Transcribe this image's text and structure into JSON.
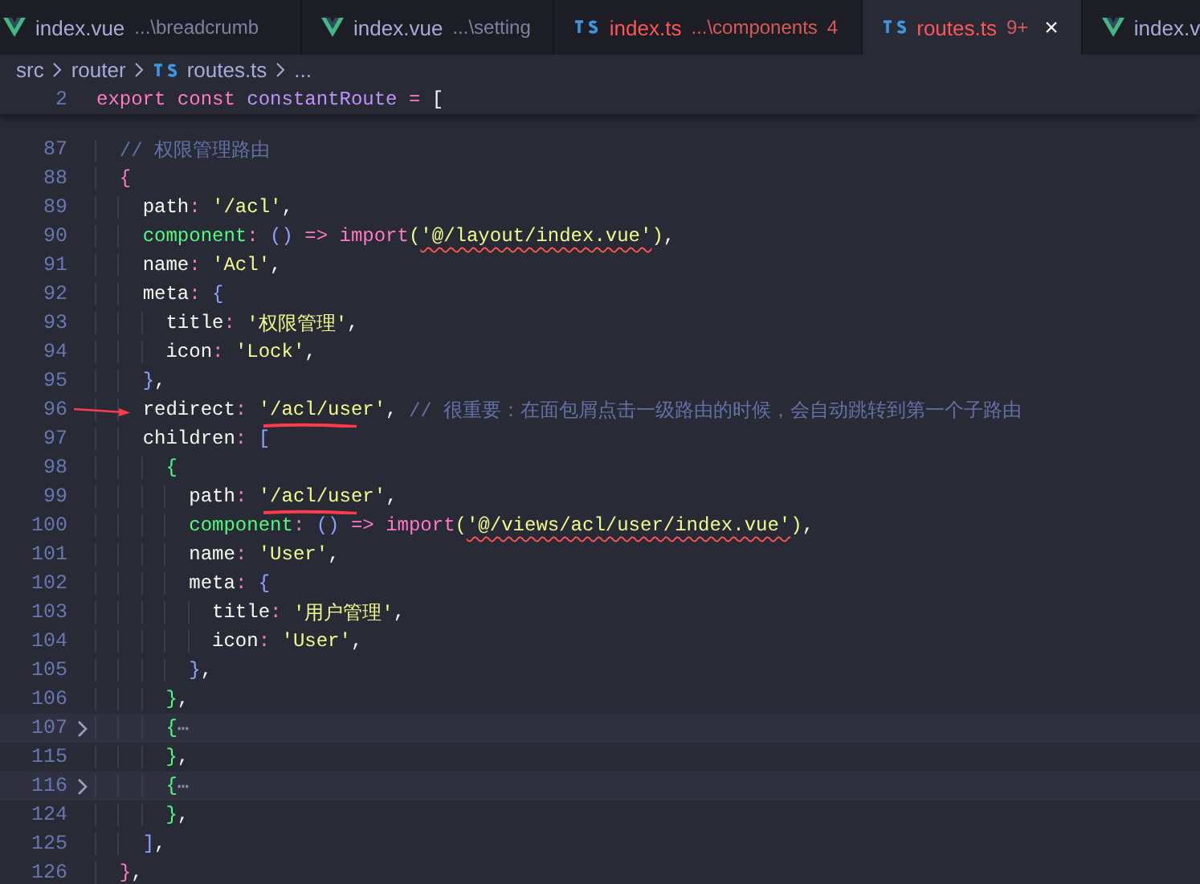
{
  "tabs": [
    {
      "kind": "vue",
      "name": "index.vue",
      "hint": "...\\breadcrumb",
      "error": false,
      "selected": false
    },
    {
      "kind": "vue",
      "name": "index.vue",
      "hint": "...\\setting",
      "error": false,
      "selected": false
    },
    {
      "kind": "ts",
      "name": "index.ts",
      "hint": "...\\components",
      "badge": "4",
      "error": true,
      "selected": false
    },
    {
      "kind": "ts",
      "name": "routes.ts",
      "badge": "9+",
      "error": true,
      "selected": true,
      "close": "×"
    },
    {
      "kind": "vue",
      "name": "index.v",
      "error": false,
      "selected": false
    }
  ],
  "breadcrumb": [
    {
      "kind": "folder",
      "text": "src"
    },
    {
      "kind": "folder",
      "text": "router"
    },
    {
      "kind": "ts",
      "text": "routes.ts"
    },
    {
      "kind": "more",
      "text": "..."
    }
  ],
  "sticky_line": {
    "number": "2",
    "tokens": [
      {
        "text": "export ",
        "kind": "kw"
      },
      {
        "text": "const ",
        "kind": "kw"
      },
      {
        "text": "constantRoute",
        "kind": "var"
      },
      {
        "text": " = ",
        "kind": "op"
      },
      {
        "text": "[",
        "kind": "plain"
      }
    ]
  },
  "lines": [
    {
      "number": "87",
      "tokens": [
        {
          "text": "  // 权限管理路由",
          "kind": "comment"
        }
      ]
    },
    {
      "number": "88",
      "tokens": [
        {
          "text": "  {",
          "kind": "b1"
        }
      ]
    },
    {
      "number": "89",
      "tokens": [
        {
          "text": "    path",
          "kind": "prop"
        },
        {
          "text": ": ",
          "kind": "op"
        },
        {
          "text": "'/acl'",
          "kind": "str"
        },
        {
          "text": ",",
          "kind": "plain"
        }
      ]
    },
    {
      "number": "90",
      "tokens": [
        {
          "text": "    component",
          "kind": "func"
        },
        {
          "text": ": ",
          "kind": "op"
        },
        {
          "text": "() ",
          "kind": "b2"
        },
        {
          "text": "=> ",
          "kind": "op"
        },
        {
          "text": "import",
          "kind": "kw"
        },
        {
          "text": "(",
          "kind": "b4"
        },
        {
          "text": "'@/layout/index.vue'",
          "kind": "str",
          "error": true
        },
        {
          "text": ")",
          "kind": "b4"
        },
        {
          "text": ",",
          "kind": "plain"
        }
      ]
    },
    {
      "number": "91",
      "tokens": [
        {
          "text": "    name",
          "kind": "prop"
        },
        {
          "text": ": ",
          "kind": "op"
        },
        {
          "text": "'Acl'",
          "kind": "str"
        },
        {
          "text": ",",
          "kind": "plain"
        }
      ]
    },
    {
      "number": "92",
      "tokens": [
        {
          "text": "    meta",
          "kind": "prop"
        },
        {
          "text": ": ",
          "kind": "op"
        },
        {
          "text": "{",
          "kind": "b2"
        }
      ]
    },
    {
      "number": "93",
      "tokens": [
        {
          "text": "      title",
          "kind": "prop"
        },
        {
          "text": ": ",
          "kind": "op"
        },
        {
          "text": "'权限管理'",
          "kind": "str"
        },
        {
          "text": ",",
          "kind": "plain"
        }
      ]
    },
    {
      "number": "94",
      "tokens": [
        {
          "text": "      icon",
          "kind": "prop"
        },
        {
          "text": ": ",
          "kind": "op"
        },
        {
          "text": "'Lock'",
          "kind": "str"
        },
        {
          "text": ",",
          "kind": "plain"
        }
      ]
    },
    {
      "number": "95",
      "tokens": [
        {
          "text": "    }",
          "kind": "b2"
        },
        {
          "text": ",",
          "kind": "plain"
        }
      ]
    },
    {
      "number": "96",
      "arrow": true,
      "tokens": [
        {
          "text": "    redirect",
          "kind": "prop"
        },
        {
          "text": ": ",
          "kind": "op"
        },
        {
          "text": "'/acl/user'",
          "kind": "str",
          "marked": true
        },
        {
          "text": ", ",
          "kind": "plain"
        },
        {
          "text": "// 很重要：在面包屑点击一级路由的时候，会自动跳转到第一个子路由",
          "kind": "comment"
        }
      ]
    },
    {
      "number": "97",
      "tokens": [
        {
          "text": "    children",
          "kind": "prop"
        },
        {
          "text": ": ",
          "kind": "op"
        },
        {
          "text": "[",
          "kind": "b2"
        }
      ]
    },
    {
      "number": "98",
      "tokens": [
        {
          "text": "      {",
          "kind": "b3"
        }
      ]
    },
    {
      "number": "99",
      "tokens": [
        {
          "text": "        path",
          "kind": "prop"
        },
        {
          "text": ": ",
          "kind": "op"
        },
        {
          "text": "'/acl/user'",
          "kind": "str",
          "marked": true
        },
        {
          "text": ",",
          "kind": "plain"
        }
      ]
    },
    {
      "number": "100",
      "tokens": [
        {
          "text": "        component",
          "kind": "func"
        },
        {
          "text": ": ",
          "kind": "op"
        },
        {
          "text": "() ",
          "kind": "b2"
        },
        {
          "text": "=> ",
          "kind": "op"
        },
        {
          "text": "import",
          "kind": "kw"
        },
        {
          "text": "(",
          "kind": "b4"
        },
        {
          "text": "'@/views/acl/user/index.vue'",
          "kind": "str",
          "error": true
        },
        {
          "text": ")",
          "kind": "b4"
        },
        {
          "text": ",",
          "kind": "plain"
        }
      ]
    },
    {
      "number": "101",
      "tokens": [
        {
          "text": "        name",
          "kind": "prop"
        },
        {
          "text": ": ",
          "kind": "op"
        },
        {
          "text": "'User'",
          "kind": "str"
        },
        {
          "text": ",",
          "kind": "plain"
        }
      ]
    },
    {
      "number": "102",
      "tokens": [
        {
          "text": "        meta",
          "kind": "prop"
        },
        {
          "text": ": ",
          "kind": "op"
        },
        {
          "text": "{",
          "kind": "b2"
        }
      ]
    },
    {
      "number": "103",
      "tokens": [
        {
          "text": "          title",
          "kind": "prop"
        },
        {
          "text": ": ",
          "kind": "op"
        },
        {
          "text": "'用户管理'",
          "kind": "str"
        },
        {
          "text": ",",
          "kind": "plain"
        }
      ]
    },
    {
      "number": "104",
      "tokens": [
        {
          "text": "          icon",
          "kind": "prop"
        },
        {
          "text": ": ",
          "kind": "op"
        },
        {
          "text": "'User'",
          "kind": "str"
        },
        {
          "text": ",",
          "kind": "plain"
        }
      ]
    },
    {
      "number": "105",
      "tokens": [
        {
          "text": "        }",
          "kind": "b2"
        },
        {
          "text": ",",
          "kind": "plain"
        }
      ]
    },
    {
      "number": "106",
      "tokens": [
        {
          "text": "      }",
          "kind": "b3"
        },
        {
          "text": ",",
          "kind": "plain"
        }
      ]
    },
    {
      "number": "107",
      "folded": true,
      "tokens": [
        {
          "text": "      {",
          "kind": "b3"
        },
        {
          "text": "⋯",
          "kind": "fold"
        }
      ]
    },
    {
      "number": "115",
      "tokens": [
        {
          "text": "      }",
          "kind": "b3"
        },
        {
          "text": ",",
          "kind": "plain"
        }
      ]
    },
    {
      "number": "116",
      "folded": true,
      "tokens": [
        {
          "text": "      {",
          "kind": "b3"
        },
        {
          "text": "⋯",
          "kind": "fold"
        }
      ]
    },
    {
      "number": "124",
      "tokens": [
        {
          "text": "      }",
          "kind": "b3"
        },
        {
          "text": ",",
          "kind": "plain"
        }
      ]
    },
    {
      "number": "125",
      "tokens": [
        {
          "text": "    ]",
          "kind": "b2"
        },
        {
          "text": ",",
          "kind": "plain"
        }
      ]
    },
    {
      "number": "126",
      "tokens": [
        {
          "text": "  }",
          "kind": "b1"
        },
        {
          "text": ",",
          "kind": "plain"
        }
      ]
    }
  ]
}
